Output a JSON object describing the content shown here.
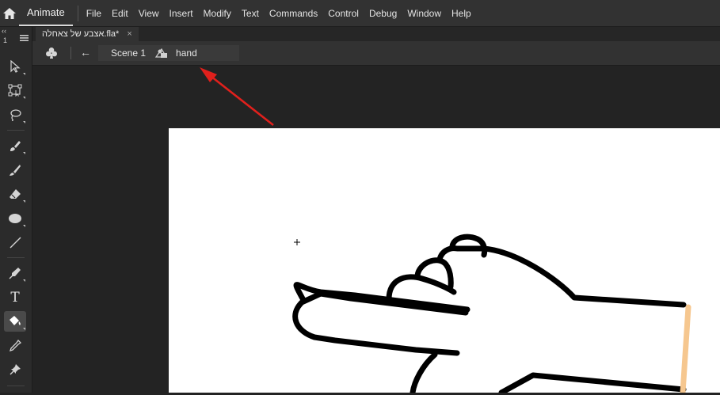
{
  "app": {
    "name": "Animate"
  },
  "menu": [
    "File",
    "Edit",
    "View",
    "Insert",
    "Modify",
    "Text",
    "Commands",
    "Control",
    "Debug",
    "Window",
    "Help"
  ],
  "toolbar": {
    "collapse_indicator": "‹‹",
    "panel_number": "1",
    "tools": [
      {
        "name": "selection-tool",
        "icon": "arrow-icon"
      },
      {
        "name": "free-transform-tool",
        "icon": "free-transform-icon"
      },
      {
        "name": "lasso-tool",
        "icon": "lasso-icon"
      },
      {
        "name": "paint-brush-tool",
        "icon": "paint-brush-icon"
      },
      {
        "name": "brush-tool",
        "icon": "brush-icon"
      },
      {
        "name": "eraser-tool",
        "icon": "eraser-icon"
      },
      {
        "name": "oval-tool",
        "icon": "oval-icon"
      },
      {
        "name": "line-tool",
        "icon": "line-icon"
      },
      {
        "name": "pen-tool",
        "icon": "pen-icon"
      },
      {
        "name": "text-tool",
        "icon": "text-icon",
        "glyph": "T"
      },
      {
        "name": "paint-bucket-tool",
        "icon": "paint-bucket-icon",
        "active": true
      },
      {
        "name": "eyedropper-tool",
        "icon": "eyedropper-icon"
      },
      {
        "name": "pin-tool",
        "icon": "pin-icon"
      }
    ]
  },
  "document_tab": {
    "title": "אצבע של צאחלה.fla*",
    "close": "×"
  },
  "edit_bar": {
    "back_arrow": "←",
    "scene_label": "Scene 1",
    "symbol_label": "hand",
    "symbol_icon": "graphic-symbol-icon"
  },
  "stage": {
    "background": "#ffffff",
    "cursor": "+",
    "drawing": "hand outline",
    "stroke_color": "#000000",
    "wrist_color": "#f6c78f"
  },
  "annotation": {
    "arrow_color": "#e0201c"
  },
  "colors": {
    "menubar": "#323232",
    "toolbar": "#2b2b2b",
    "pasteboard": "#232323"
  }
}
